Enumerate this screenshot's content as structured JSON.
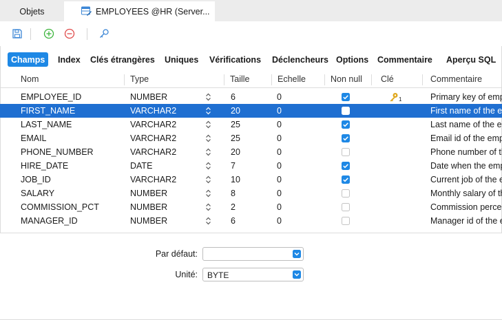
{
  "tabs": [
    {
      "label": "Objets"
    },
    {
      "label": "EMPLOYEES @HR (Server..."
    }
  ],
  "toolbar": {
    "icons": [
      "save-icon",
      "add-icon",
      "remove-icon",
      "key-icon"
    ]
  },
  "subtabs": [
    {
      "label": "Champs",
      "selected": true
    },
    {
      "label": "Index"
    },
    {
      "label": "Clés étrangères"
    },
    {
      "label": "Uniques"
    },
    {
      "label": "Vérifications"
    },
    {
      "label": "Déclencheurs"
    },
    {
      "label": "Options"
    },
    {
      "label": "Commentaire"
    },
    {
      "label": "Aperçu SQL"
    }
  ],
  "columns": [
    "Nom",
    "Type",
    "Taille",
    "Echelle",
    "Non null",
    "Clé",
    "Commentaire"
  ],
  "rows": [
    {
      "name": "EMPLOYEE_ID",
      "type": "NUMBER",
      "size": "6",
      "scale": "0",
      "not_null": true,
      "key": "1",
      "comment": "Primary key of empl"
    },
    {
      "name": "FIRST_NAME",
      "type": "VARCHAR2",
      "size": "20",
      "scale": "0",
      "not_null": false,
      "key": "",
      "comment": "First name of the em",
      "selected": true
    },
    {
      "name": "LAST_NAME",
      "type": "VARCHAR2",
      "size": "25",
      "scale": "0",
      "not_null": true,
      "key": "",
      "comment": "Last name of the em"
    },
    {
      "name": "EMAIL",
      "type": "VARCHAR2",
      "size": "25",
      "scale": "0",
      "not_null": true,
      "key": "",
      "comment": "Email id of the empl"
    },
    {
      "name": "PHONE_NUMBER",
      "type": "VARCHAR2",
      "size": "20",
      "scale": "0",
      "not_null": false,
      "key": "",
      "comment": "Phone number of th"
    },
    {
      "name": "HIRE_DATE",
      "type": "DATE",
      "size": "7",
      "scale": "0",
      "not_null": true,
      "key": "",
      "comment": "Date when the empl"
    },
    {
      "name": "JOB_ID",
      "type": "VARCHAR2",
      "size": "10",
      "scale": "0",
      "not_null": true,
      "key": "",
      "comment": "Current job of the e"
    },
    {
      "name": "SALARY",
      "type": "NUMBER",
      "size": "8",
      "scale": "0",
      "not_null": false,
      "key": "",
      "comment": "Monthly salary of th"
    },
    {
      "name": "COMMISSION_PCT",
      "type": "NUMBER",
      "size": "2",
      "scale": "0",
      "not_null": false,
      "key": "",
      "comment": "Commission percen"
    },
    {
      "name": "MANAGER_ID",
      "type": "NUMBER",
      "size": "6",
      "scale": "0",
      "not_null": false,
      "key": "",
      "comment": "Manager id of the e"
    }
  ],
  "properties": {
    "default_label": "Par défaut:",
    "default_value": "",
    "unit_label": "Unité:",
    "unit_value": "BYTE"
  },
  "colors": {
    "accent": "#1e88e5",
    "selection": "#1f6fd1",
    "add_icon": "#3cb43c",
    "remove_icon": "#e04a4a",
    "key_icon": "#e0a81e"
  }
}
